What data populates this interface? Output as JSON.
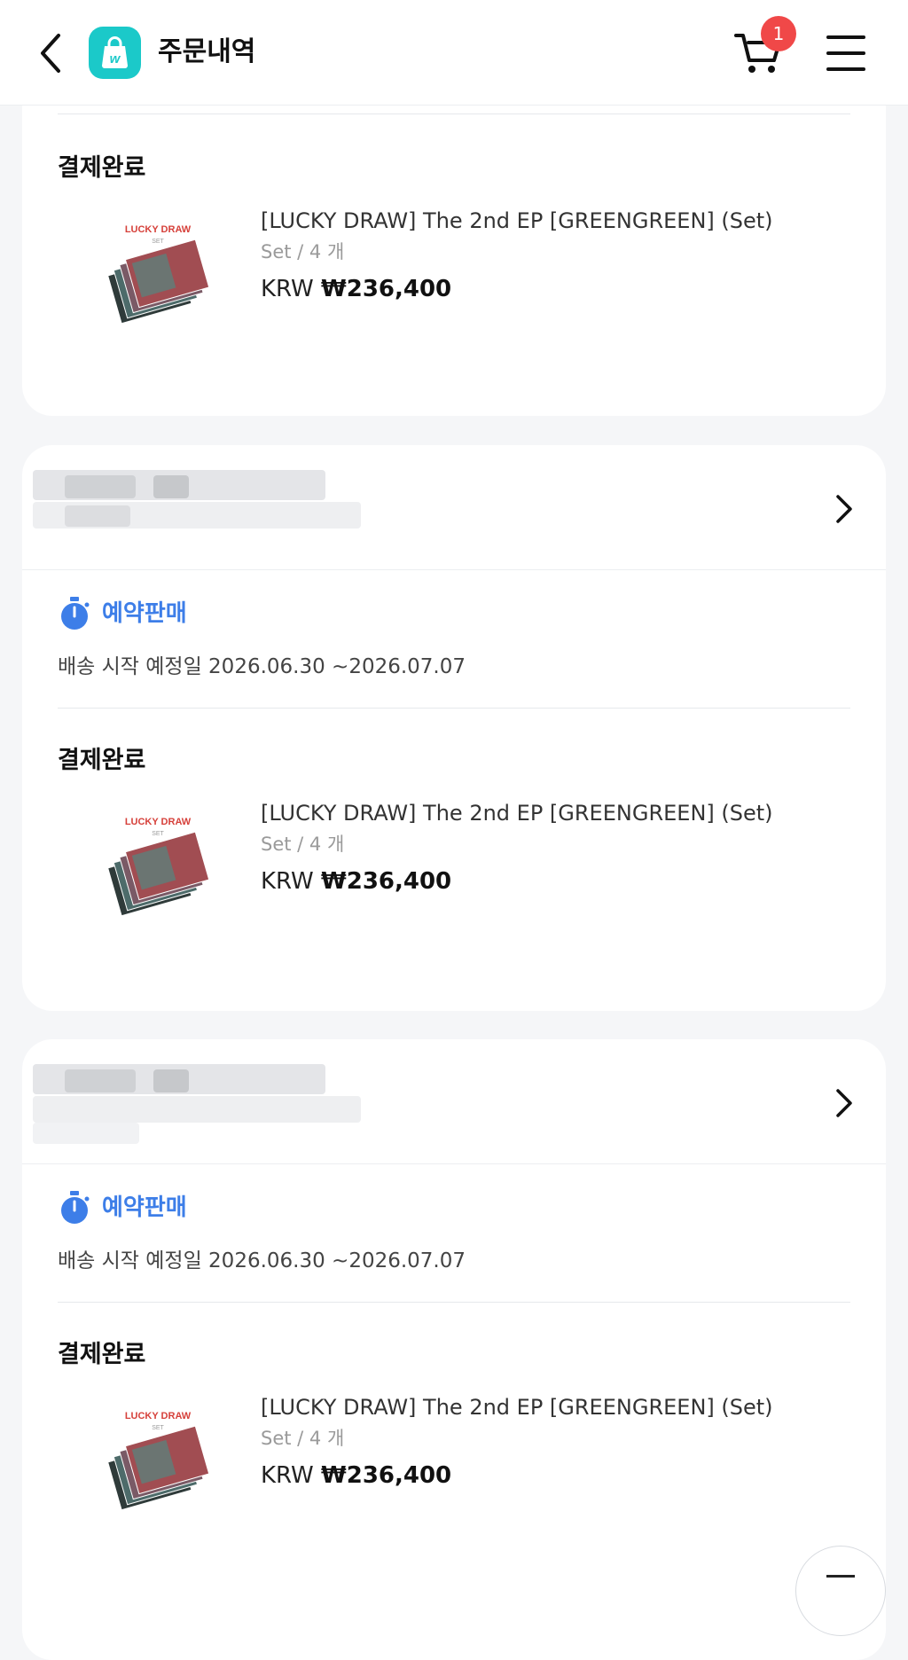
{
  "header": {
    "title": "주문내역",
    "cart_count": "1"
  },
  "orders": [
    {
      "status": "결제완료",
      "product": {
        "name": "[LUCKY DRAW] The 2nd EP [GREENGREEN] (Set)",
        "option": "Set / 4 개",
        "currency": "KRW",
        "price": "₩236,400",
        "thumb_text": "LUCKY DRAW",
        "thumb_sub": "SET"
      }
    },
    {
      "reserve_label": "예약판매",
      "ship_date": "배송 시작 예정일 2026.06.30 ~2026.07.07",
      "status": "결제완료",
      "product": {
        "name": "[LUCKY DRAW] The 2nd EP [GREENGREEN] (Set)",
        "option": "Set / 4 개",
        "currency": "KRW",
        "price": "₩236,400",
        "thumb_text": "LUCKY DRAW",
        "thumb_sub": "SET"
      }
    },
    {
      "reserve_label": "예약판매",
      "ship_date": "배송 시작 예정일 2026.06.30 ~2026.07.07",
      "status": "결제완료",
      "product": {
        "name": "[LUCKY DRAW] The 2nd EP [GREENGREEN] (Set)",
        "option": "Set / 4 개",
        "currency": "KRW",
        "price": "₩236,400",
        "thumb_text": "LUCKY DRAW",
        "thumb_sub": "SET"
      }
    }
  ],
  "colors": {
    "accent_blue": "#3d7ee8",
    "logo_teal": "#1bc9c9",
    "badge_red": "#f04848"
  },
  "icons": {
    "back": "chevron-left-icon",
    "logo": "shopping-bag-icon",
    "cart": "cart-icon",
    "menu": "hamburger-menu-icon",
    "order_detail": "chevron-right-icon",
    "reserve": "timer-icon",
    "scroll_top": "scroll-top-icon"
  }
}
